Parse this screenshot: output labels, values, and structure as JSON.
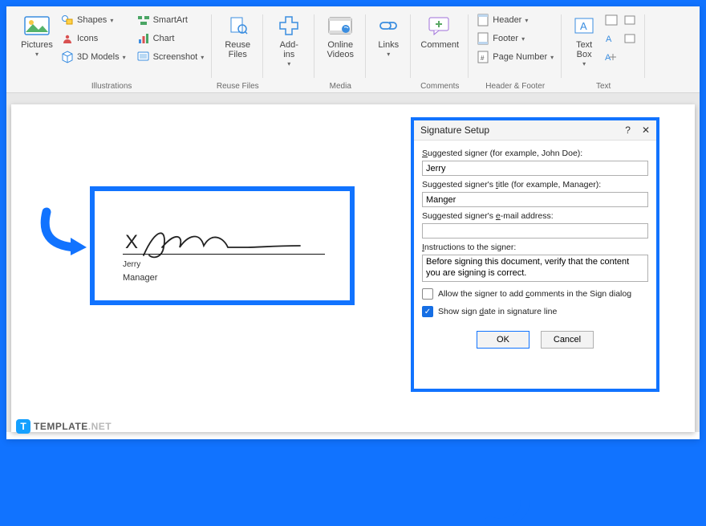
{
  "ribbon": {
    "illustrations": {
      "label": "Illustrations",
      "pictures": "Pictures",
      "shapes": "Shapes",
      "icons": "Icons",
      "models3d": "3D Models",
      "smartart": "SmartArt",
      "chart": "Chart",
      "screenshot": "Screenshot"
    },
    "reuse": {
      "label": "Reuse Files",
      "btn": "Reuse\nFiles"
    },
    "addins": {
      "label": "",
      "btn": "Add-\nins"
    },
    "media": {
      "label": "Media",
      "btn": "Online\nVideos"
    },
    "links": {
      "label": "",
      "btn": "Links"
    },
    "comments": {
      "label": "Comments",
      "btn": "Comment"
    },
    "headerfooter": {
      "label": "Header & Footer",
      "header": "Header",
      "footer": "Footer",
      "pagenum": "Page Number"
    },
    "text": {
      "label": "Text",
      "textbox": "Text\nBox"
    }
  },
  "signature": {
    "x": "X",
    "name": "Jerry",
    "role": "Manager"
  },
  "dialog": {
    "title": "Signature Setup",
    "help": "?",
    "lbl_signer": "Suggested signer (for example, John Doe):",
    "val_signer": "Jerry",
    "lbl_title": "Suggested signer's title (for example, Manager):",
    "val_title": "Manger",
    "lbl_email": "Suggested signer's e-mail address:",
    "val_email": "",
    "lbl_instr": "Instructions to the signer:",
    "val_instr": "Before signing this document, verify that the content you are signing is correct.",
    "chk_comments": "Allow the signer to add comments in the Sign dialog",
    "chk_date": "Show sign date in signature line",
    "ok": "OK",
    "cancel": "Cancel"
  },
  "footer": {
    "badge": "T",
    "brand": "TEMPLATE",
    "suffix": ".NET"
  }
}
